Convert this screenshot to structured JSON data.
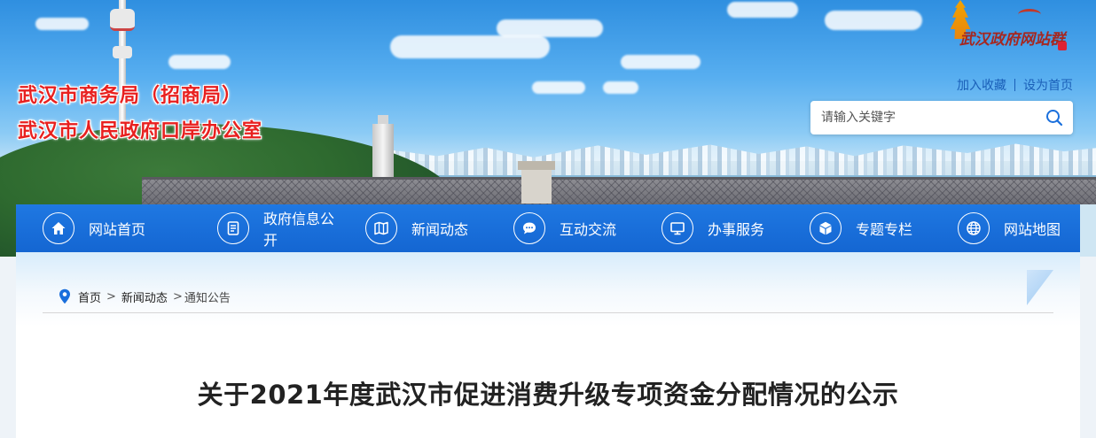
{
  "header": {
    "dept_line1": "武汉市商务局（招商局）",
    "dept_line2": "武汉市人民政府口岸办公室",
    "logo_text": "武汉政府网站群",
    "links": {
      "favorite": "加入收藏",
      "homepage": "设为首页"
    },
    "search": {
      "placeholder": "请输入关键字",
      "icon": "search-icon"
    }
  },
  "nav": {
    "items": [
      {
        "label": "网站首页",
        "icon": "home-icon"
      },
      {
        "label": "政府信息公开",
        "icon": "document-icon"
      },
      {
        "label": "新闻动态",
        "icon": "newspaper-icon"
      },
      {
        "label": "互动交流",
        "icon": "chat-icon"
      },
      {
        "label": "办事服务",
        "icon": "monitor-icon"
      },
      {
        "label": "专题专栏",
        "icon": "cube-icon"
      },
      {
        "label": "网站地图",
        "icon": "globe-icon"
      }
    ]
  },
  "breadcrumb": {
    "icon": "location-pin-icon",
    "items": [
      "首页",
      "新闻动态",
      "通知公告"
    ]
  },
  "article": {
    "title": "关于2021年度武汉市促进消费升级专项资金分配情况的公示"
  },
  "colors": {
    "nav_bg": "#1a6fdc",
    "dept_text": "#e8201f",
    "link": "#1a5fb8",
    "title": "#222222"
  }
}
